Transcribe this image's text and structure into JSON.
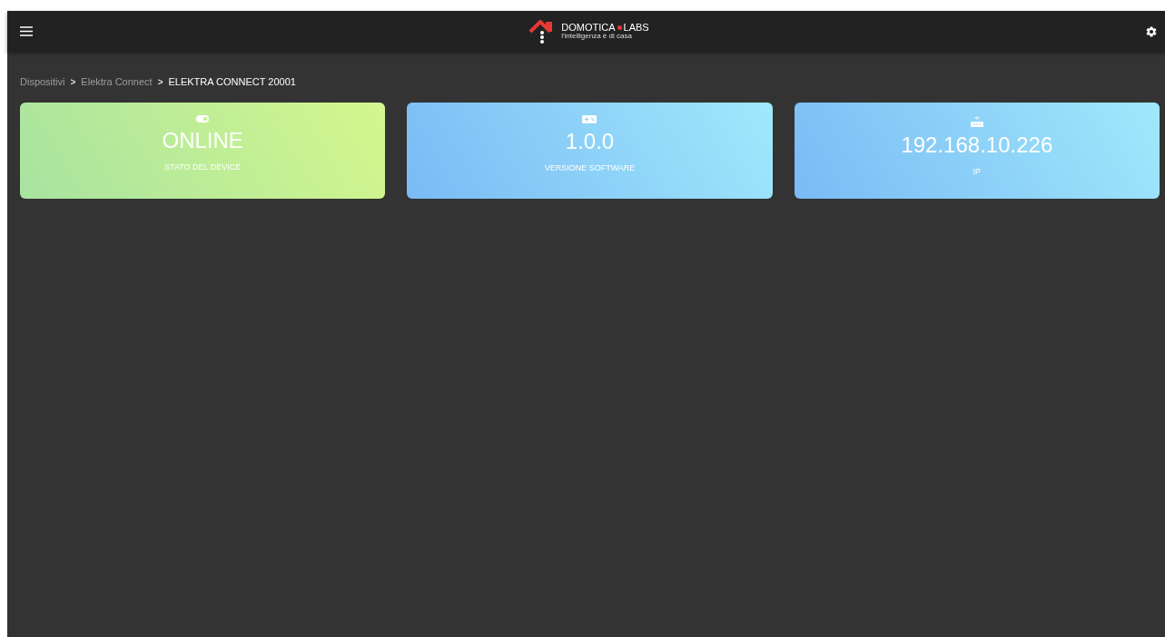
{
  "header": {
    "logo": {
      "name": "DOMOTICA",
      "name_suffix": "LABS",
      "tagline": "l'intelligenza è di casa"
    }
  },
  "breadcrumb": {
    "items": [
      {
        "label": "Dispositivi",
        "selected": false
      },
      {
        "label": "Elektra Connect",
        "selected": false
      },
      {
        "label": "ELEKTRA CONNECT 20001",
        "selected": true
      }
    ],
    "separators": [
      ">",
      ">"
    ]
  },
  "cards": [
    {
      "kind": "toggle",
      "value": "ONLINE",
      "label": "STATO DEL DEVICE"
    },
    {
      "kind": "gamepad",
      "value": "1.0.0",
      "label": "VERSIONE SOFTWARE"
    },
    {
      "kind": "router",
      "value": "192.168.10.226",
      "label": "IP"
    }
  ]
}
